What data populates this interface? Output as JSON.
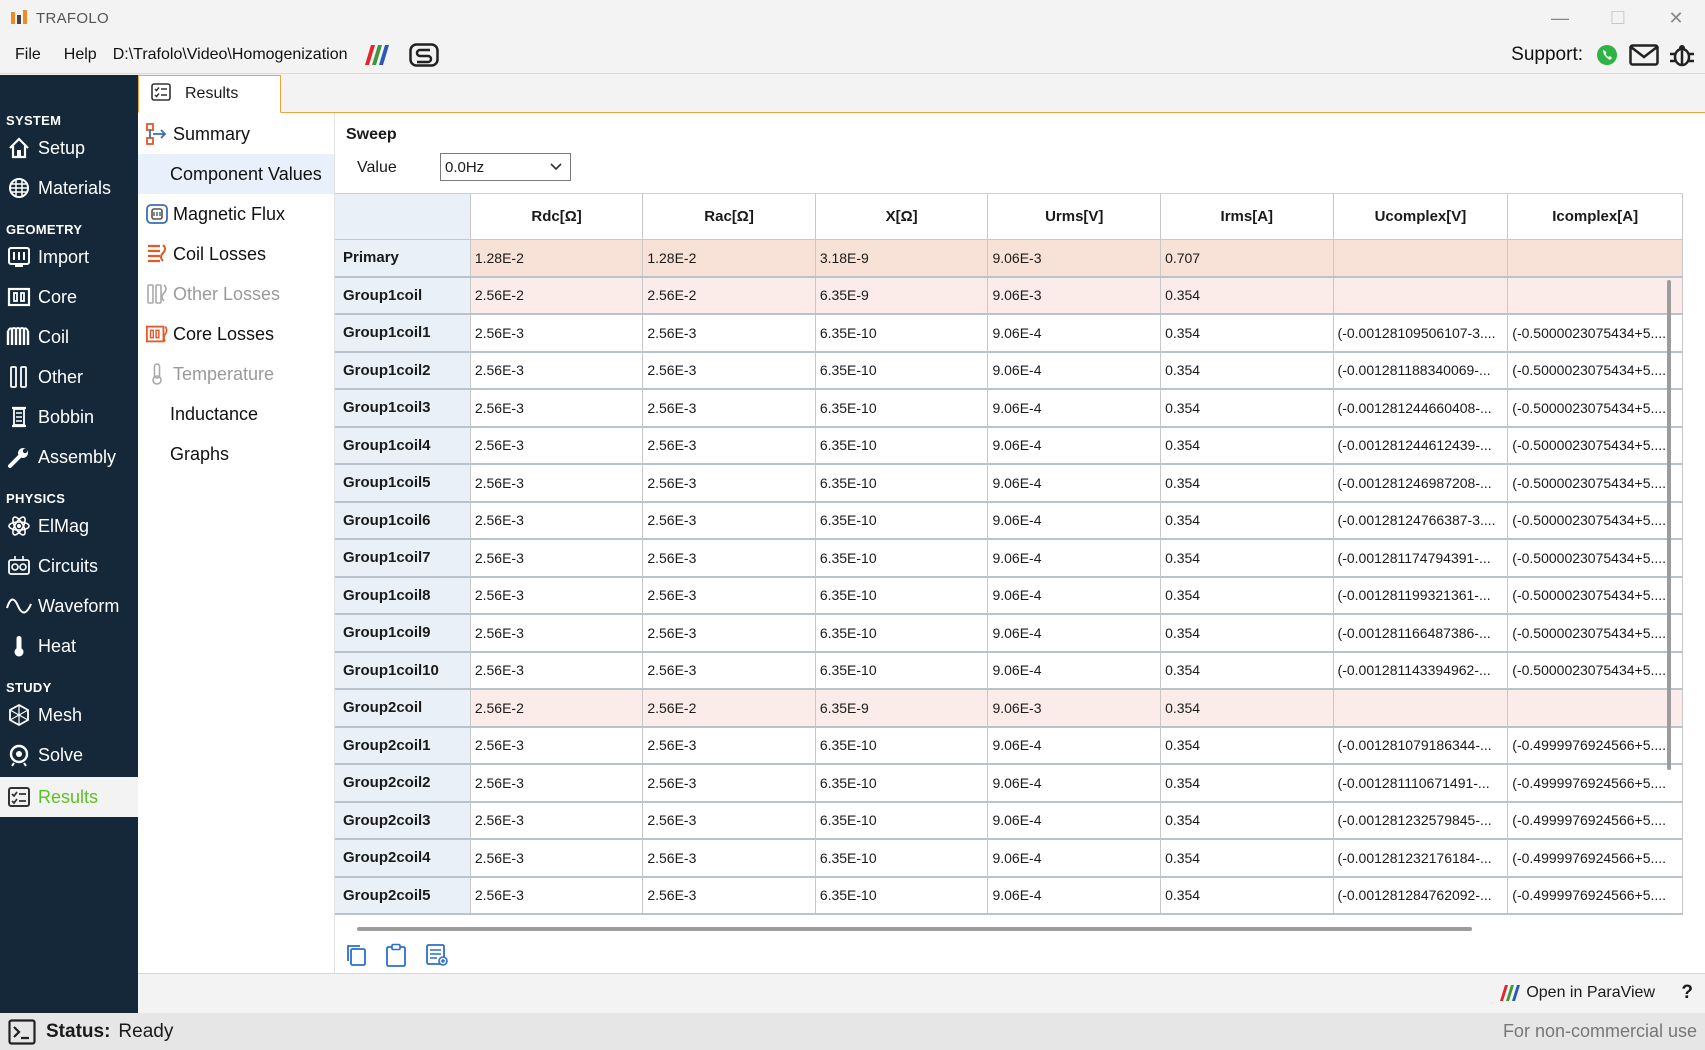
{
  "window": {
    "title": "TRAFOLO",
    "minimize": "—",
    "maximize": "☐",
    "close": "✕"
  },
  "menu": {
    "file": "File",
    "help": "Help",
    "path": "D:\\Trafolo\\Video\\Homogenization",
    "support_label": "Support:"
  },
  "nav": {
    "sections": [
      {
        "title": "SYSTEM",
        "items": [
          {
            "label": "Setup",
            "icon": "home-icon"
          },
          {
            "label": "Materials",
            "icon": "materials-icon"
          }
        ]
      },
      {
        "title": "GEOMETRY",
        "items": [
          {
            "label": "Import",
            "icon": "import-icon"
          },
          {
            "label": "Core",
            "icon": "core-icon"
          },
          {
            "label": "Coil",
            "icon": "coil-icon"
          },
          {
            "label": "Other",
            "icon": "other-icon"
          },
          {
            "label": "Bobbin",
            "icon": "bobbin-icon"
          },
          {
            "label": "Assembly",
            "icon": "wrench-icon"
          }
        ]
      },
      {
        "title": "PHYSICS",
        "items": [
          {
            "label": "ElMag",
            "icon": "atom-icon"
          },
          {
            "label": "Circuits",
            "icon": "circuits-icon"
          },
          {
            "label": "Waveform",
            "icon": "waveform-icon"
          },
          {
            "label": "Heat",
            "icon": "thermometer-icon"
          }
        ]
      },
      {
        "title": "STUDY",
        "items": [
          {
            "label": "Mesh",
            "icon": "mesh-icon"
          },
          {
            "label": "Solve",
            "icon": "solve-icon"
          }
        ]
      }
    ],
    "results": "Results",
    "accent": "#5fbf2a"
  },
  "tab": {
    "label": "Results"
  },
  "subnav": {
    "summary": "Summary",
    "component_values": "Component Values",
    "magnetic_flux": "Magnetic Flux",
    "coil_losses": "Coil Losses",
    "other_losses": "Other Losses",
    "core_losses": "Core Losses",
    "temperature": "Temperature",
    "inductance": "Inductance",
    "graphs": "Graphs"
  },
  "sweep": {
    "title": "Sweep",
    "value_label": "Value",
    "value": "0.0Hz"
  },
  "table": {
    "columns": [
      "Rdc[Ω]",
      "Rac[Ω]",
      "X[Ω]",
      "Urms[V]",
      "Irms[A]",
      "Ucomplex[V]",
      "Icomplex[A]"
    ],
    "rows": [
      {
        "name": "Primary",
        "kind": "primary",
        "cells": [
          "1.28E-2",
          "1.28E-2",
          "3.18E-9",
          "9.06E-3",
          "0.707",
          "",
          ""
        ]
      },
      {
        "name": "Group1coil",
        "kind": "group",
        "cells": [
          "2.56E-2",
          "2.56E-2",
          "6.35E-9",
          "9.06E-3",
          "0.354",
          "",
          ""
        ]
      },
      {
        "name": "Group1coil1",
        "kind": "coil",
        "cells": [
          "2.56E-3",
          "2.56E-3",
          "6.35E-10",
          "9.06E-4",
          "0.354",
          "(-0.00128109506107-3....",
          "(-0.5000023075434+5...."
        ]
      },
      {
        "name": "Group1coil2",
        "kind": "coil",
        "cells": [
          "2.56E-3",
          "2.56E-3",
          "6.35E-10",
          "9.06E-4",
          "0.354",
          "(-0.001281188340069-...",
          "(-0.5000023075434+5...."
        ]
      },
      {
        "name": "Group1coil3",
        "kind": "coil",
        "cells": [
          "2.56E-3",
          "2.56E-3",
          "6.35E-10",
          "9.06E-4",
          "0.354",
          "(-0.001281244660408-...",
          "(-0.5000023075434+5...."
        ]
      },
      {
        "name": "Group1coil4",
        "kind": "coil",
        "cells": [
          "2.56E-3",
          "2.56E-3",
          "6.35E-10",
          "9.06E-4",
          "0.354",
          "(-0.001281244612439-...",
          "(-0.5000023075434+5...."
        ]
      },
      {
        "name": "Group1coil5",
        "kind": "coil",
        "cells": [
          "2.56E-3",
          "2.56E-3",
          "6.35E-10",
          "9.06E-4",
          "0.354",
          "(-0.001281246987208-...",
          "(-0.5000023075434+5...."
        ]
      },
      {
        "name": "Group1coil6",
        "kind": "coil",
        "cells": [
          "2.56E-3",
          "2.56E-3",
          "6.35E-10",
          "9.06E-4",
          "0.354",
          "(-0.00128124766387-3....",
          "(-0.5000023075434+5...."
        ]
      },
      {
        "name": "Group1coil7",
        "kind": "coil",
        "cells": [
          "2.56E-3",
          "2.56E-3",
          "6.35E-10",
          "9.06E-4",
          "0.354",
          "(-0.001281174794391-...",
          "(-0.5000023075434+5...."
        ]
      },
      {
        "name": "Group1coil8",
        "kind": "coil",
        "cells": [
          "2.56E-3",
          "2.56E-3",
          "6.35E-10",
          "9.06E-4",
          "0.354",
          "(-0.001281199321361-...",
          "(-0.5000023075434+5...."
        ]
      },
      {
        "name": "Group1coil9",
        "kind": "coil",
        "cells": [
          "2.56E-3",
          "2.56E-3",
          "6.35E-10",
          "9.06E-4",
          "0.354",
          "(-0.001281166487386-...",
          "(-0.5000023075434+5...."
        ]
      },
      {
        "name": "Group1coil10",
        "kind": "coil",
        "cells": [
          "2.56E-3",
          "2.56E-3",
          "6.35E-10",
          "9.06E-4",
          "0.354",
          "(-0.001281143394962-...",
          "(-0.5000023075434+5...."
        ]
      },
      {
        "name": "Group2coil",
        "kind": "group",
        "cells": [
          "2.56E-2",
          "2.56E-2",
          "6.35E-9",
          "9.06E-3",
          "0.354",
          "",
          ""
        ]
      },
      {
        "name": "Group2coil1",
        "kind": "coil",
        "cells": [
          "2.56E-3",
          "2.56E-3",
          "6.35E-10",
          "9.06E-4",
          "0.354",
          "(-0.001281079186344-...",
          "(-0.4999976924566+5...."
        ]
      },
      {
        "name": "Group2coil2",
        "kind": "coil",
        "cells": [
          "2.56E-3",
          "2.56E-3",
          "6.35E-10",
          "9.06E-4",
          "0.354",
          "(-0.001281110671491-...",
          "(-0.4999976924566+5...."
        ]
      },
      {
        "name": "Group2coil3",
        "kind": "coil",
        "cells": [
          "2.56E-3",
          "2.56E-3",
          "6.35E-10",
          "9.06E-4",
          "0.354",
          "(-0.001281232579845-...",
          "(-0.4999976924566+5...."
        ]
      },
      {
        "name": "Group2coil4",
        "kind": "coil",
        "cells": [
          "2.56E-3",
          "2.56E-3",
          "6.35E-10",
          "9.06E-4",
          "0.354",
          "(-0.001281232176184-...",
          "(-0.4999976924566+5...."
        ]
      },
      {
        "name": "Group2coil5",
        "kind": "coil",
        "cells": [
          "2.56E-3",
          "2.56E-3",
          "6.35E-10",
          "9.06E-4",
          "0.354",
          "(-0.001281284762092-...",
          "(-0.4999976924566+5...."
        ]
      }
    ]
  },
  "footer": {
    "paraview": "Open in ParaView",
    "help": "?"
  },
  "status": {
    "label": "Status:",
    "value": "Ready",
    "license": "For non-commercial use"
  }
}
